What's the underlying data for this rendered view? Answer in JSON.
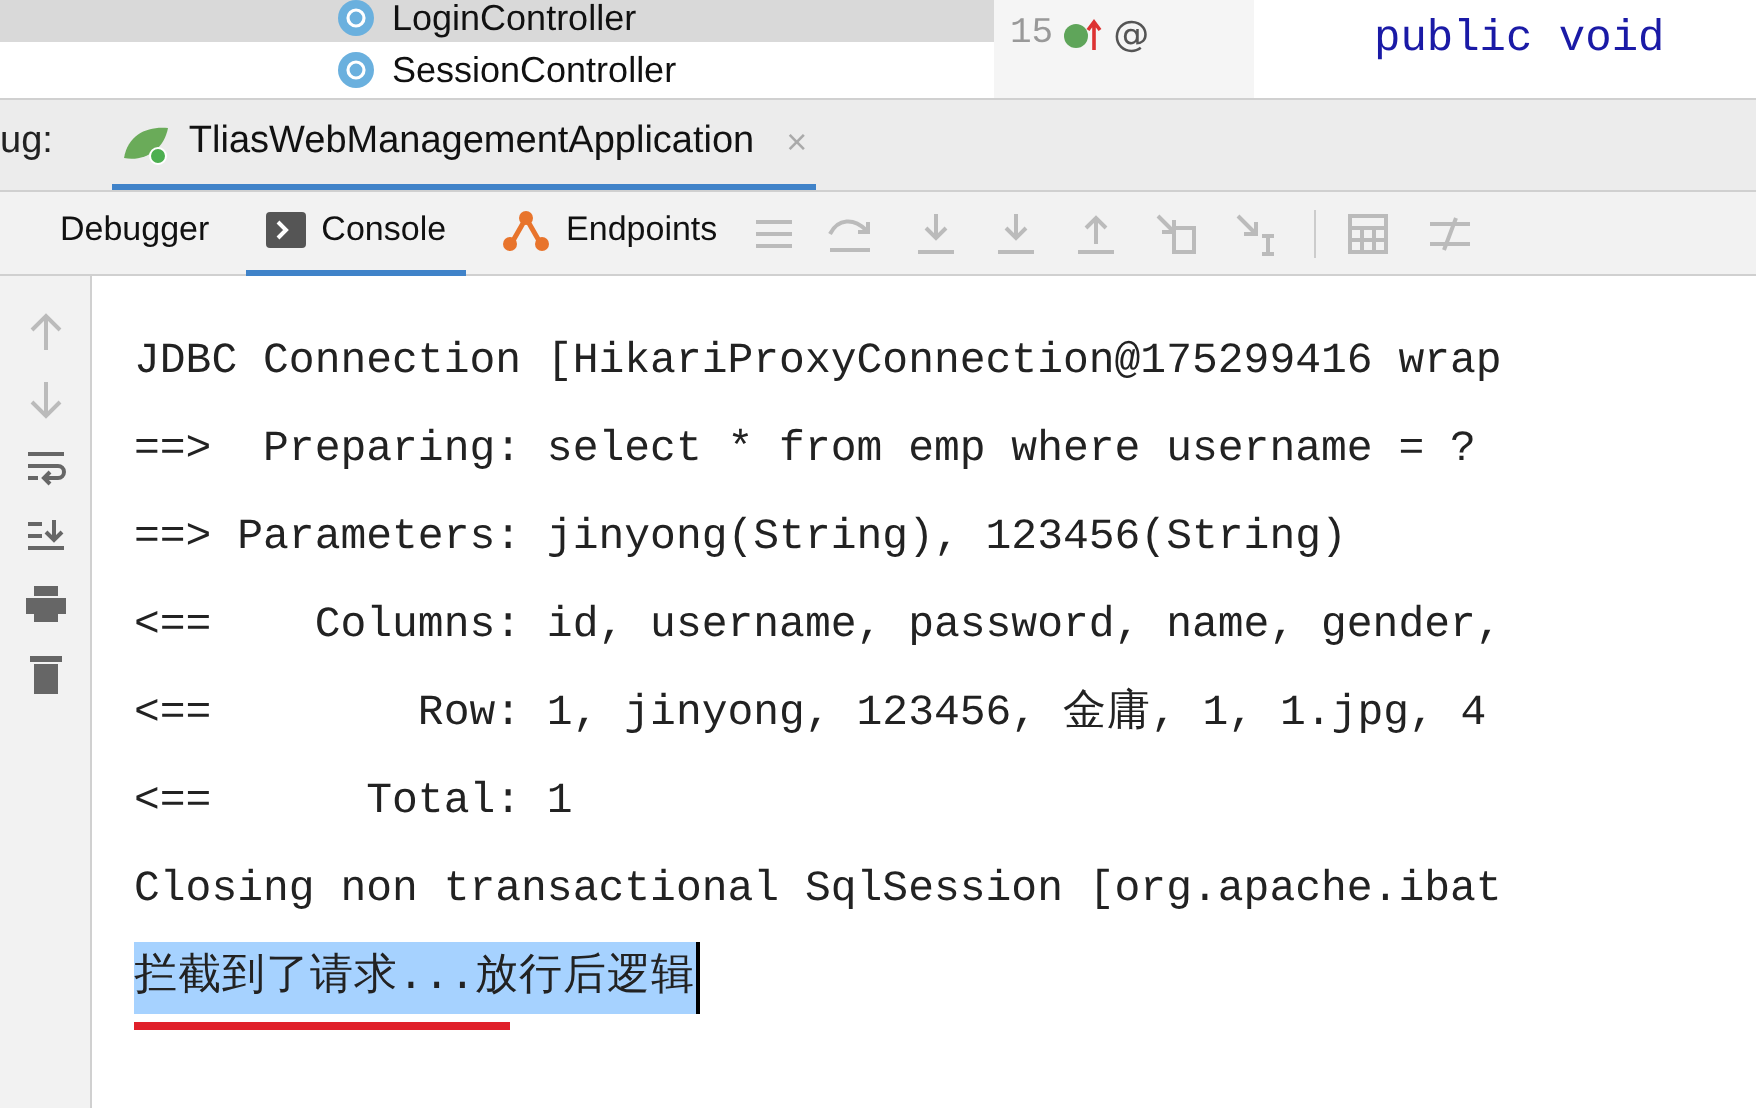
{
  "project_tree": {
    "items": [
      {
        "label": "LoginController",
        "selected": true
      },
      {
        "label": "SessionController",
        "selected": false
      }
    ]
  },
  "editor": {
    "line_number": "15",
    "gutter_mark": "@",
    "code": "public void"
  },
  "debug_bar": {
    "label": "ug:",
    "tab": {
      "title": "TliasWebManagementApplication",
      "close": "×",
      "selected": true
    }
  },
  "toolbar": {
    "tabs": [
      {
        "label": "Debugger",
        "kind": "plain",
        "selected": false
      },
      {
        "label": "Console",
        "kind": "console",
        "selected": true
      },
      {
        "label": "Endpoints",
        "kind": "endpoints",
        "selected": false
      }
    ]
  },
  "console": {
    "lines": [
      {
        "text": "JDBC Connection [HikariProxyConnection@175299416 wrap",
        "selected": false,
        "underlined": false
      },
      {
        "text": "==>  Preparing: select * from emp where username = ?",
        "selected": false,
        "underlined": false
      },
      {
        "text": "==> Parameters: jinyong(String), 123456(String)",
        "selected": false,
        "underlined": false
      },
      {
        "text": "<==    Columns: id, username, password, name, gender,",
        "selected": false,
        "underlined": false
      },
      {
        "text": "<==        Row: 1, jinyong, 123456, 金庸, 1, 1.jpg, 4",
        "selected": false,
        "underlined": false
      },
      {
        "text": "<==      Total: 1",
        "selected": false,
        "underlined": false
      },
      {
        "text": "Closing non transactional SqlSession [org.apache.ibat",
        "selected": false,
        "underlined": false
      },
      {
        "text": "拦截到了请求...放行后逻辑",
        "selected": true,
        "underlined": true
      }
    ]
  }
}
